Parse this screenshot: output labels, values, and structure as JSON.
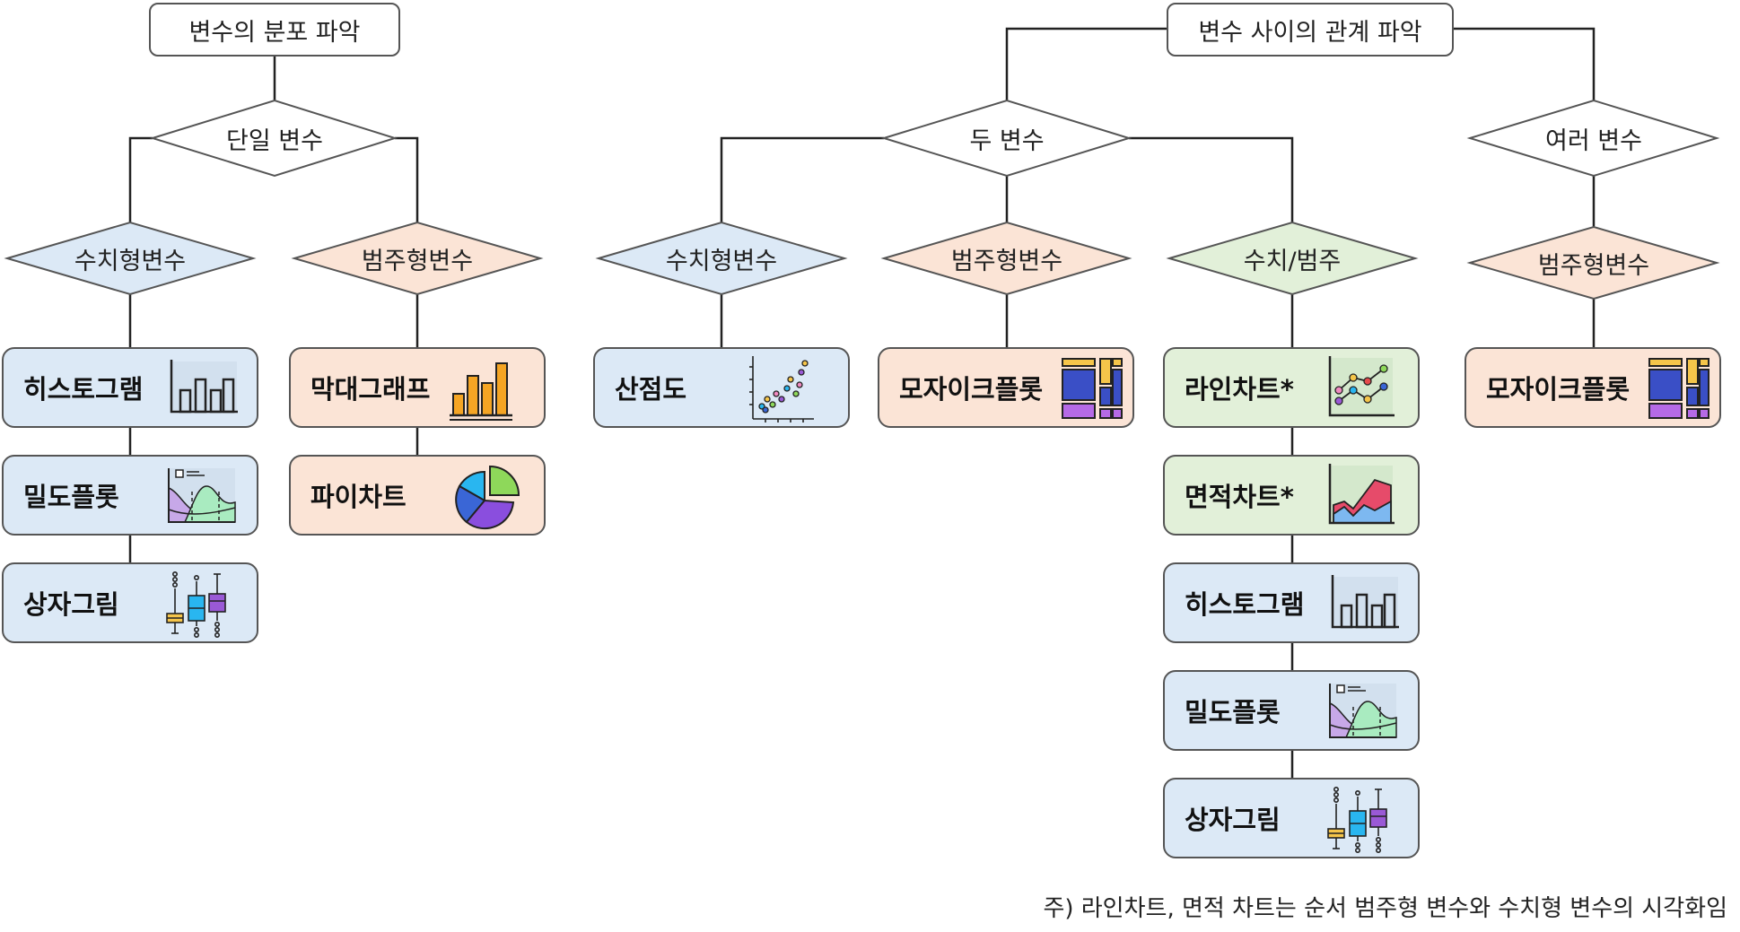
{
  "headers": {
    "distribution": "변수의 분포 파악",
    "relationship": "변수 사이의 관계 파악"
  },
  "decisions": {
    "single": "단일 변수",
    "two": "두 변수",
    "multi": "여러 변수",
    "single_numeric": "수치형변수",
    "single_categorical": "범주형변수",
    "two_numeric": "수치형변수",
    "two_categorical": "범주형변수",
    "two_mixed": "수치/범주",
    "multi_categorical": "범주형변수"
  },
  "charts": {
    "histogram_1": "히스토그램",
    "density_1": "밀도플롯",
    "boxplot_1": "상자그림",
    "bar": "막대그래프",
    "pie": "파이차트",
    "scatter": "산점도",
    "mosaic_1": "모자이크플롯",
    "line": "라인차트*",
    "area": "면적차트*",
    "histogram_2": "히스토그램",
    "density_2": "밀도플롯",
    "boxplot_2": "상자그림",
    "mosaic_2": "모자이크플롯"
  },
  "footnote": "주) 라인차트, 면적 차트는 순서 범주형 변수와 수치형 변수의 시각화임",
  "colors": {
    "numeric": "#dce9f6",
    "categorical": "#fbe4d6",
    "mixed": "#e2f0d9",
    "outline": "#555555"
  },
  "icons": {
    "histogram": "histogram-icon",
    "density": "density-plot-icon",
    "boxplot": "boxplot-icon",
    "bar": "bar-chart-icon",
    "pie": "pie-chart-icon",
    "scatter": "scatter-plot-icon",
    "mosaic": "mosaic-plot-icon",
    "line": "line-chart-icon",
    "area": "area-chart-icon"
  }
}
